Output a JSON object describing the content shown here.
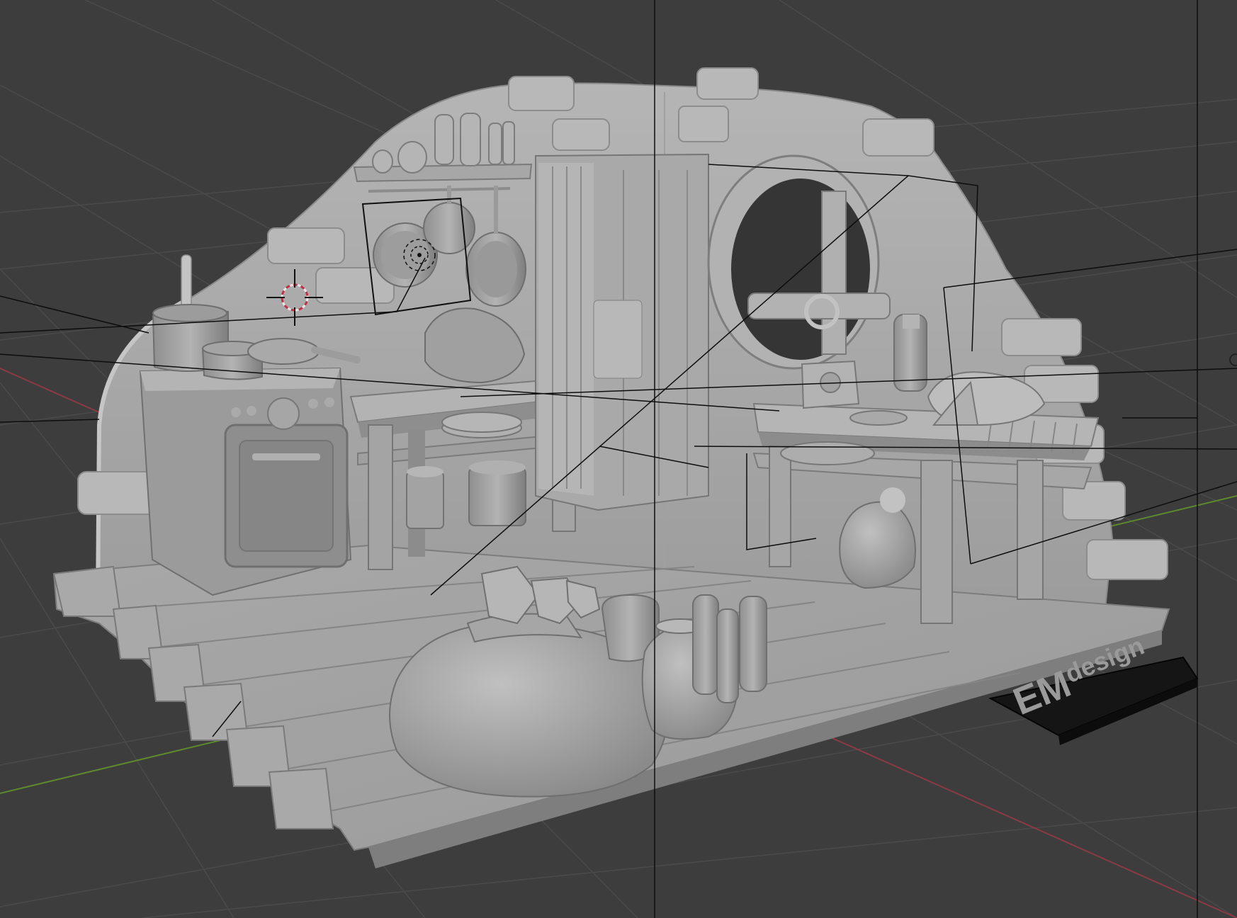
{
  "app": {
    "name": "3D viewport",
    "mode": "solid-shading"
  },
  "colors": {
    "background": "#3d3d3d",
    "grid": "#4a4a4a",
    "axis_x": "#8a3a44",
    "axis_y": "#5d8a2c",
    "model_light": "#a3a3a3",
    "model_mid": "#8e8e8e",
    "model_dark": "#6e6e6e",
    "logo_plate": "#151515",
    "logo_text": "#9a9a9a"
  },
  "logo": {
    "mark": "EM",
    "text": "design"
  },
  "scene": {
    "objects": [
      "stone-wall",
      "wooden-floor",
      "stove",
      "cooking-pot",
      "frying-pan",
      "pan-rack",
      "shelf-bottles",
      "back-table",
      "plate-stack",
      "cabinet",
      "round-window",
      "right-table",
      "grain-sack",
      "jars",
      "bottles",
      "bread-loaf",
      "small-sack",
      "wall-bricks"
    ],
    "cursor_icon": "3d-cursor-icon",
    "light_icon": "light-gizmo-icon"
  }
}
